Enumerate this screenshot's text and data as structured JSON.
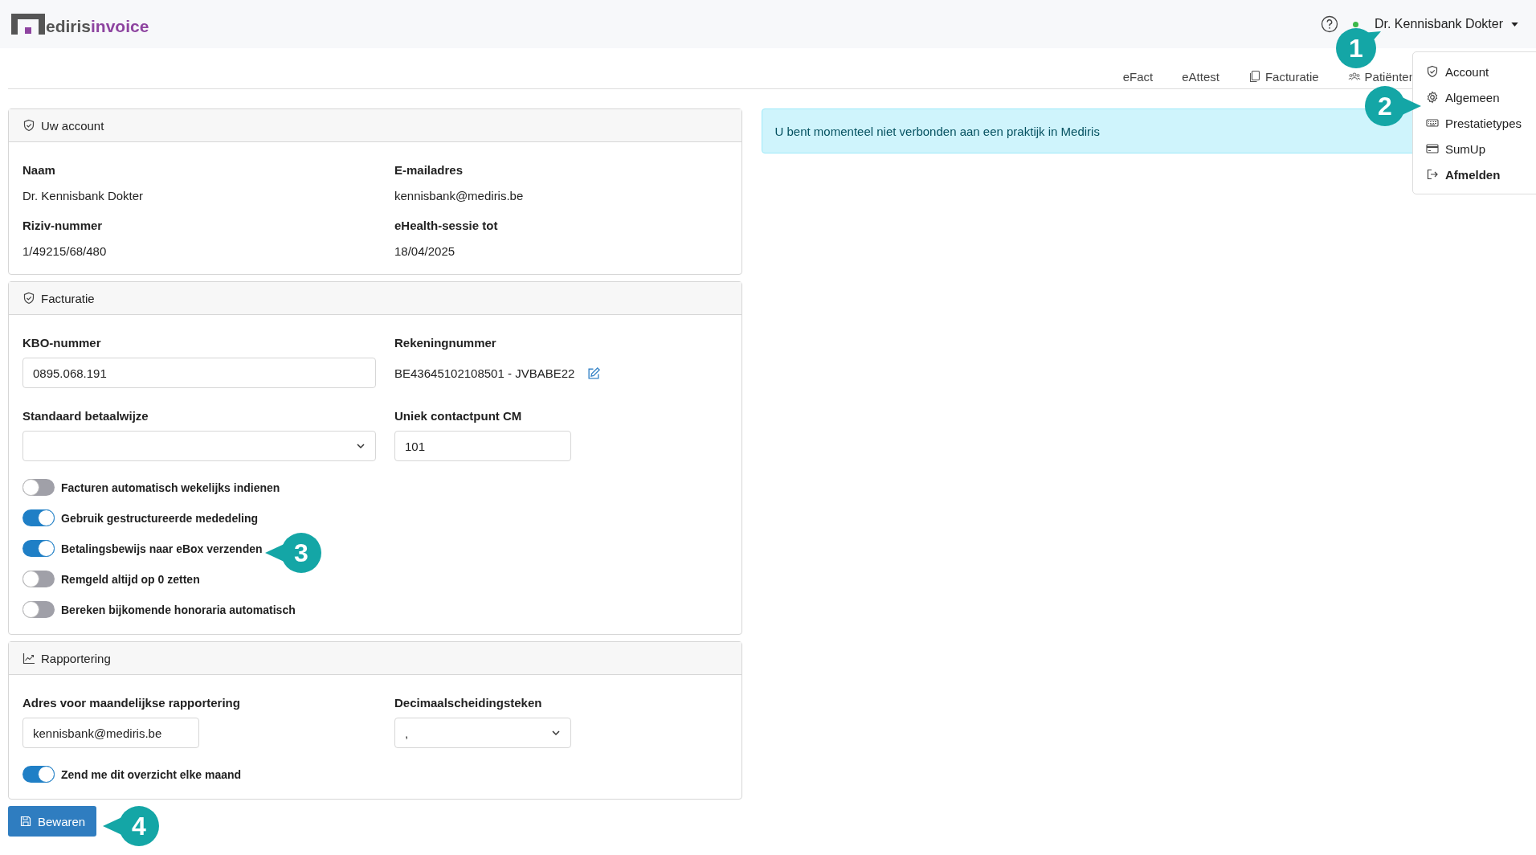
{
  "header": {
    "logo": {
      "text_dark": "ediris",
      "text_accent": "invoice"
    },
    "user": {
      "name": "Dr. Kennisbank Dokter",
      "online": true
    }
  },
  "nav": [
    {
      "label": "eFact",
      "kind": "plain"
    },
    {
      "label": "eAttest",
      "kind": "plain"
    },
    {
      "label": "Facturatie",
      "kind": "copy"
    },
    {
      "label": "Patiënten",
      "kind": "users"
    }
  ],
  "user_menu": [
    {
      "label": "Account",
      "kind": "shield",
      "bold": false
    },
    {
      "label": "Algemeen",
      "kind": "gear",
      "bold": false
    },
    {
      "label": "Prestatietypes",
      "kind": "keyboard",
      "bold": false
    },
    {
      "label": "SumUp",
      "kind": "card",
      "bold": false
    },
    {
      "label": "Afmelden",
      "kind": "logout",
      "bold": true
    }
  ],
  "account_card": {
    "title": "Uw account",
    "fields": [
      {
        "label": "Naam",
        "value": "Dr. Kennisbank Dokter"
      },
      {
        "label": "E-mailadres",
        "value": "kennisbank@mediris.be"
      },
      {
        "label": "Riziv-nummer",
        "value": "1/49215/68/480"
      },
      {
        "label": "eHealth-sessie tot",
        "value": "18/04/2025"
      }
    ]
  },
  "billing_card": {
    "title": "Facturatie",
    "kbo": {
      "label": "KBO-nummer",
      "value": "0895.068.191"
    },
    "account_number": {
      "label": "Rekeningnummer",
      "value": "BE43645102108501 - JVBABE22"
    },
    "payment_method": {
      "label": "Standaard betaalwijze"
    },
    "contact_point": {
      "label": "Uniek contactpunt CM",
      "value": "101"
    },
    "toggles": [
      {
        "label": "Facturen automatisch wekelijks indienen",
        "checked": false
      },
      {
        "label": "Gebruik gestructureerde mededeling",
        "checked": true
      },
      {
        "label": "Betalingsbewijs naar eBox verzenden",
        "checked": true
      },
      {
        "label": "Remgeld altijd op 0 zetten",
        "checked": false
      },
      {
        "label": "Bereken bijkomende honoraria automatisch",
        "checked": false
      }
    ]
  },
  "report_card": {
    "title": "Rapportering",
    "address": {
      "label": "Adres voor maandelijkse rapportering",
      "value": "kennisbank@mediris.be"
    },
    "decimal": {
      "label": "Decimaalscheidingsteken",
      "value": ","
    },
    "toggles": [
      {
        "label": "Zend me dit overzicht elke maand",
        "checked": true
      }
    ]
  },
  "save_button": "Bewaren",
  "alert": "U bent momenteel niet verbonden aan een praktijk in Mediris",
  "callouts": [
    {
      "number": "1"
    },
    {
      "number": "2"
    },
    {
      "number": "3"
    },
    {
      "number": "4"
    }
  ]
}
